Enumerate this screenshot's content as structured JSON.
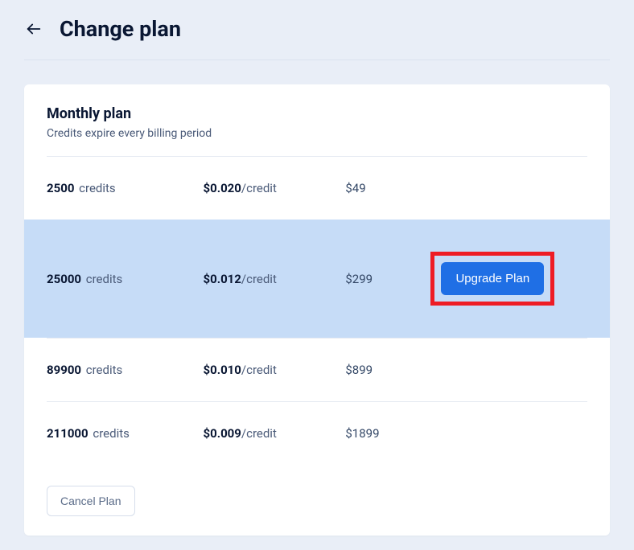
{
  "header": {
    "title": "Change plan"
  },
  "card": {
    "title": "Monthly plan",
    "subtitle": "Credits expire every billing period",
    "cancel_label": "Cancel Plan",
    "upgrade_label": "Upgrade Plan"
  },
  "plans": [
    {
      "credits": "2500",
      "credits_unit": "credits",
      "rate_price": "$0.020",
      "rate_per": "/credit",
      "total": "$49",
      "highlighted": false,
      "show_upgrade": false
    },
    {
      "credits": "25000",
      "credits_unit": "credits",
      "rate_price": "$0.012",
      "rate_per": "/credit",
      "total": "$299",
      "highlighted": true,
      "show_upgrade": true
    },
    {
      "credits": "89900",
      "credits_unit": "credits",
      "rate_price": "$0.010",
      "rate_per": "/credit",
      "total": "$899",
      "highlighted": false,
      "show_upgrade": false
    },
    {
      "credits": "211000",
      "credits_unit": "credits",
      "rate_price": "$0.009",
      "rate_per": "/credit",
      "total": "$1899",
      "highlighted": false,
      "show_upgrade": false
    }
  ]
}
